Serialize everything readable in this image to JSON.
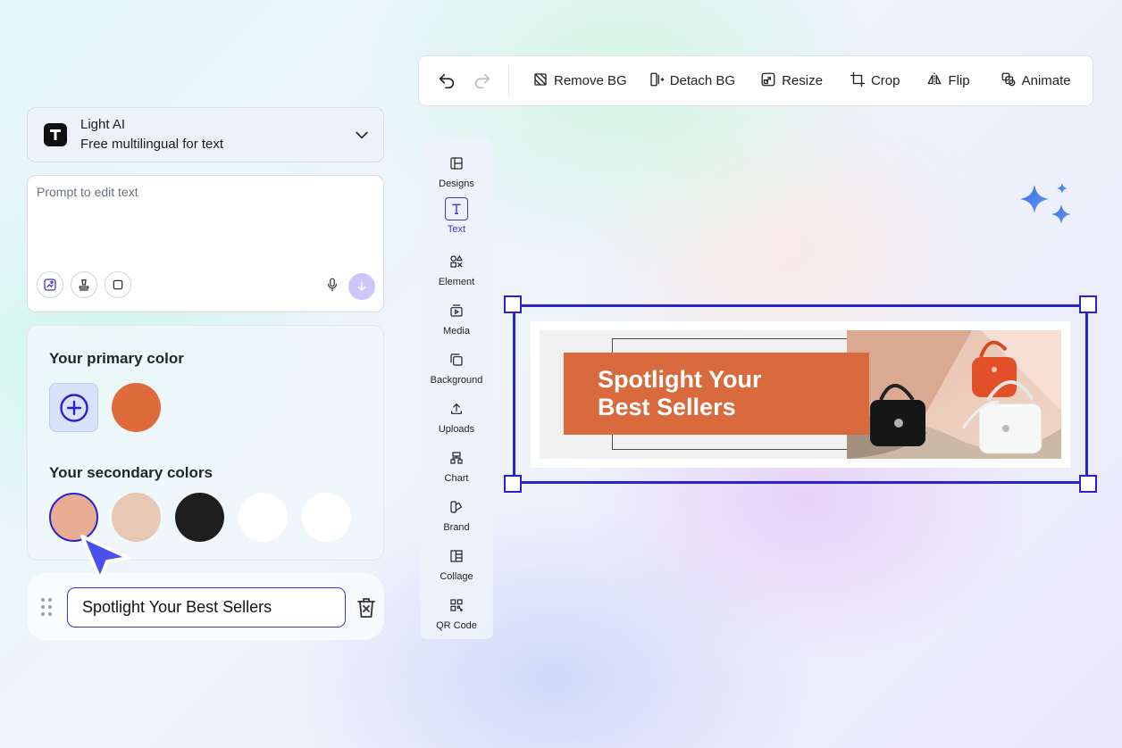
{
  "toolbar": {
    "actions": [
      {
        "label": "Remove BG",
        "icon": "remove-bg-icon"
      },
      {
        "label": "Detach BG",
        "icon": "detach-bg-icon"
      },
      {
        "label": "Resize",
        "icon": "resize-icon"
      },
      {
        "label": "Crop",
        "icon": "crop-icon"
      },
      {
        "label": "Flip",
        "icon": "flip-icon"
      },
      {
        "label": "Animate",
        "icon": "animate-icon"
      }
    ]
  },
  "model_selector": {
    "name": "Light AI",
    "description": "Free multilingual for text"
  },
  "prompt": {
    "placeholder": "Prompt to edit text"
  },
  "colors": {
    "primary_title": "Your primary color",
    "primary": [
      "#E06B3A"
    ],
    "secondary_title": "Your secondary colors",
    "secondary": [
      "#E8AD92",
      "#E6C8B3",
      "#1E1E1E",
      "#FFFFFF",
      "#FFFFFF"
    ],
    "selected_index": 0
  },
  "text_item": {
    "value": "Spotlight Your Best Sellers"
  },
  "side_panel": {
    "items": [
      {
        "label": "Designs",
        "icon": "designs-icon"
      },
      {
        "label": "Text",
        "icon": "text-icon",
        "active": true
      },
      {
        "label": "Element",
        "icon": "element-icon"
      },
      {
        "label": "Media",
        "icon": "media-icon"
      },
      {
        "label": "Background",
        "icon": "background-icon"
      },
      {
        "label": "Uploads",
        "icon": "uploads-icon"
      },
      {
        "label": "Chart",
        "icon": "chart-icon"
      },
      {
        "label": "Brand",
        "icon": "brand-icon"
      },
      {
        "label": "Collage",
        "icon": "collage-icon"
      },
      {
        "label": "QR Code",
        "icon": "qr-code-icon"
      }
    ]
  },
  "canvas": {
    "headline_line1": "Spotlight Your",
    "headline_line2": "Best Sellers",
    "accent_color": "#2A22D0",
    "banner_color": "#D96A3E"
  }
}
